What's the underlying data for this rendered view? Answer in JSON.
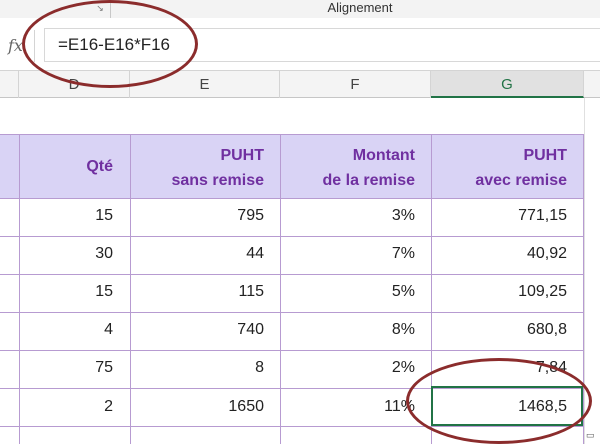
{
  "ribbon": {
    "group_label": "Alignement",
    "launcher_icon": "dialog-launcher-icon"
  },
  "formula_bar": {
    "fx_label": "fx",
    "formula": "=E16-E16*F16"
  },
  "columns": [
    {
      "letter": "D",
      "selected": false
    },
    {
      "letter": "E",
      "selected": false
    },
    {
      "letter": "F",
      "selected": false
    },
    {
      "letter": "G",
      "selected": true
    }
  ],
  "table": {
    "headers": {
      "qte": "Qté",
      "puht_1": "PUHT",
      "puht_2": "sans remise",
      "montant_1": "Montant",
      "montant_2": "de la remise",
      "avec_1": "PUHT",
      "avec_2": "avec remise"
    },
    "rows": [
      {
        "qte": "15",
        "puht": "795",
        "remise": "3%",
        "avec": "771,15"
      },
      {
        "qte": "30",
        "puht": "44",
        "remise": "7%",
        "avec": "40,92"
      },
      {
        "qte": "15",
        "puht": "115",
        "remise": "5%",
        "avec": "109,25"
      },
      {
        "qte": "4",
        "puht": "740",
        "remise": "8%",
        "avec": "680,8"
      },
      {
        "qte": "75",
        "puht": "8",
        "remise": "2%",
        "avec": "7,84"
      },
      {
        "qte": "2",
        "puht": "1650",
        "remise": "11%",
        "avec": "1468,5"
      }
    ]
  },
  "colors": {
    "header_fill": "#d9d3f5",
    "header_text": "#7030a0",
    "grid_line": "#b79bd1",
    "selection": "#217346",
    "annotation": "#8b2c2c"
  }
}
